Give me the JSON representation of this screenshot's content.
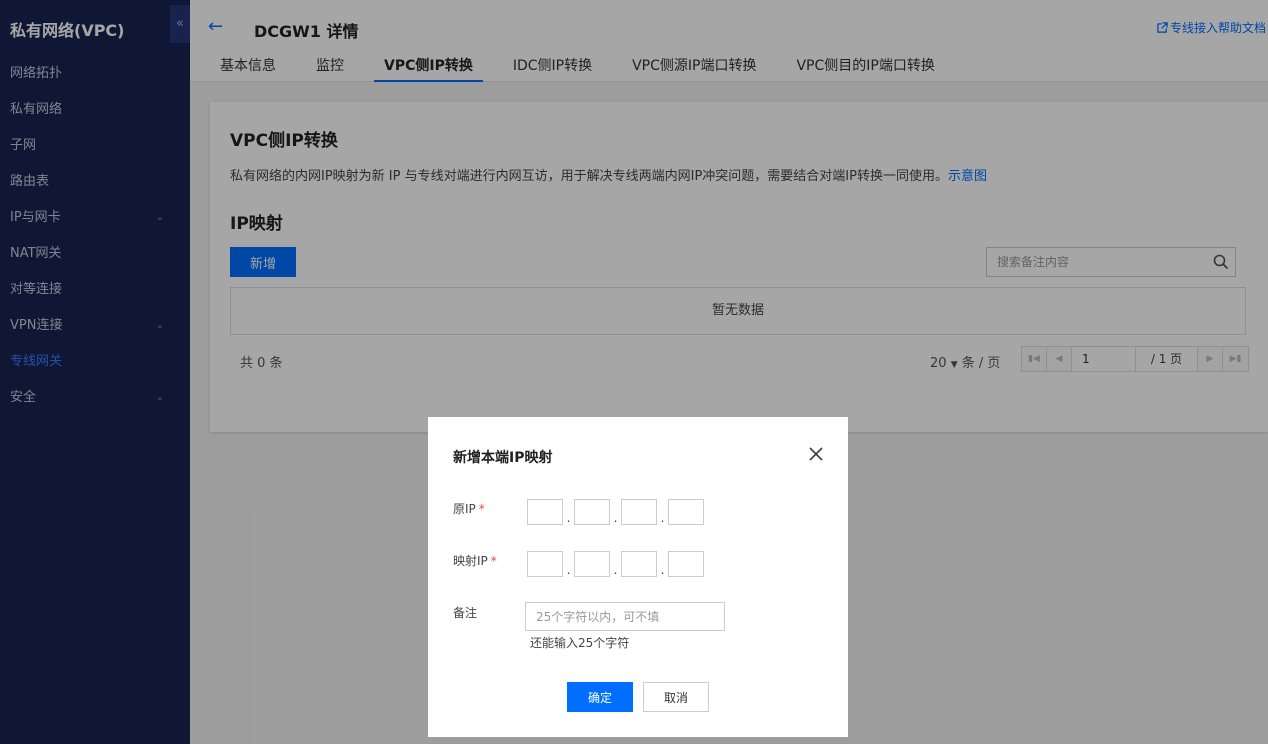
{
  "sidebar": {
    "title": "私有网络(VPC)",
    "collapse_glyph": "«",
    "items": [
      {
        "label": "网络拓扑"
      },
      {
        "label": "私有网络"
      },
      {
        "label": "子网"
      },
      {
        "label": "路由表"
      },
      {
        "label": "IP与网卡",
        "expandable": true
      },
      {
        "label": "NAT网关"
      },
      {
        "label": "对等连接"
      },
      {
        "label": "VPN连接",
        "expandable": true
      },
      {
        "label": "专线网关",
        "active": true
      },
      {
        "label": "安全",
        "expandable": true
      }
    ]
  },
  "header": {
    "back_glyph": "←",
    "title": "DCGW1 详情",
    "help_link": "专线接入帮助文档",
    "tabs": [
      {
        "label": "基本信息"
      },
      {
        "label": "监控"
      },
      {
        "label": "VPC侧IP转换",
        "active": true
      },
      {
        "label": "IDC侧IP转换"
      },
      {
        "label": "VPC侧源IP端口转换"
      },
      {
        "label": "VPC侧目的IP端口转换"
      }
    ]
  },
  "panel": {
    "title": "VPC侧IP转换",
    "description": "私有网络的内网IP映射为新 IP 与专线对端进行内网互访，用于解决专线两端内网IP冲突问题，需要结合对端IP转换一同使用。",
    "diagram_link": "示意图",
    "section_title": "IP映射",
    "add_button": "新增",
    "search_placeholder": "搜索备注内容",
    "empty_text": "暂无数据",
    "total_text": "共 0 条",
    "page_size_value": "20",
    "page_size_suffix": "条 / 页",
    "current_page": "1",
    "total_pages_text": "/ 1 页"
  },
  "modal": {
    "title": "新增本端IP映射",
    "source_ip_label": "原IP",
    "mapped_ip_label": "映射IP",
    "required_mark": "*",
    "note_label": "备注",
    "note_placeholder": "25个字符以内，可不填",
    "note_hint": "还能输入25个字符",
    "confirm_button": "确定",
    "cancel_button": "取消"
  },
  "colors": {
    "sidebar_bg": "#182450",
    "primary": "#006eff",
    "active_nav": "#3d7bff",
    "required": "#e54545"
  },
  "icons": {
    "back": "arrow-left-icon",
    "help": "external-link-icon",
    "search": "search-icon",
    "close": "close-icon",
    "expand": "chevron-down-icon",
    "collapse": "double-chevron-left-icon"
  }
}
